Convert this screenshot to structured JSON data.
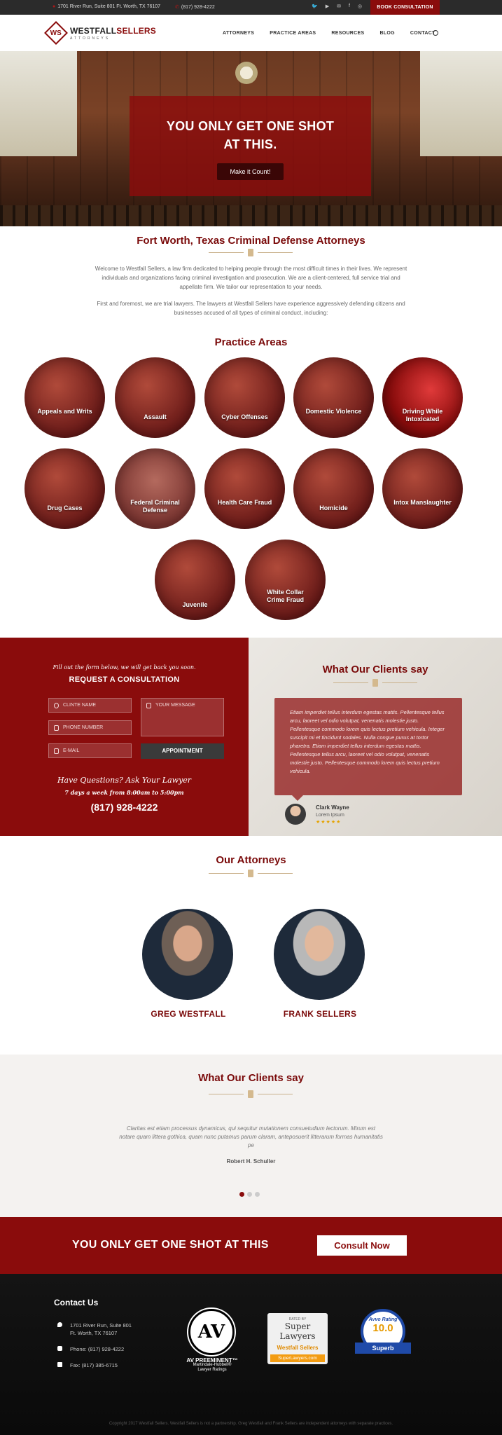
{
  "topbar": {
    "address": "1701 River Run, Suite 801  Ft. Worth, TX 76107",
    "phone": "(817) 928-4222",
    "social": [
      "twitter-icon",
      "youtube-icon",
      "email-icon",
      "facebook-icon",
      "rss-icon"
    ],
    "social_glyphs": [
      "🐦",
      "▶",
      "✉",
      "f",
      "◎"
    ],
    "book_label": "BOOK CONSULTATION"
  },
  "header": {
    "logo_mark": "WS",
    "logo_name_1": "WESTFALL",
    "logo_name_2": "SELLERS",
    "logo_sub": "ATTORNEYS",
    "nav": [
      "ATTORNEYS",
      "PRACTICE AREAS",
      "RESOURCES",
      "BLOG",
      "CONTACT"
    ]
  },
  "hero": {
    "headline_1": "YOU ONLY GET ONE SHOT",
    "headline_2": "AT THIS.",
    "button": "Make it Count!"
  },
  "intro": {
    "title": "Fort Worth, Texas Criminal Defense Attorneys",
    "p1": "Welcome to Westfall Sellers, a law firm dedicated to helping people through the most difficult times in their lives. We represent individuals and organizations facing criminal investigation and prosecution. We are a client-centered, full service trial and appellate firm. We tailor our representation to your needs.",
    "p2": "First and foremost, we are trial lawyers. The lawyers at Westfall Sellers have experience aggressively defending citizens and businesses accused of all types of criminal conduct, including:"
  },
  "practice": {
    "title": "Practice Areas",
    "items": [
      "Appeals and Writs",
      "Assault",
      "Cyber Offenses",
      "Domestic Violence",
      "Driving While Intoxicated",
      "Drug Cases",
      "Federal Criminal Defense",
      "Health Care Fraud",
      "Homicide",
      "Intox Manslaughter",
      "Juvenile",
      "White Collar Crime Fraud"
    ]
  },
  "consult": {
    "lead": "Fill out the form below, we will get back you soon.",
    "title": "REQUEST A CONSULTATION",
    "name_placeholder": "CLINTE NAME",
    "phone_placeholder": "PHONE NUMBER",
    "email_placeholder": "E-MAIL",
    "message_placeholder": "YOUR MESSAGE",
    "submit": "APPOINTMENT",
    "question": "Have Questions? Ask Your Lawyer",
    "hours": "7 days a week from 8:00am to 5:00pm",
    "phone": "(817) 928-4222"
  },
  "testimonial": {
    "title": "What Our Clients say",
    "text": "Etiam imperdiet tellus interdum egestas mattis. Pellentesque tellus arcu, laoreet vel odio volutpat, venenatis molestie justo. Pellentesque commodo lorem quis lectus pretium vehicula. Integer suscipit mi et tincidunt sodales. Nulla congue purus at tortor pharetra. Etiam imperdiet tellus interdum egestas mattis. Pellentesque tellus arcu, laoreet vel odio volutpat, venenatis molestie justo. Pellentesque commodo lorem quis lectus pretium vehicula.",
    "name": "Clark Wayne",
    "role": "Lorem Ipsum",
    "stars": "★★★★★"
  },
  "attorneys": {
    "title": "Our Attorneys",
    "people": [
      "GREG WESTFALL",
      "FRANK SELLERS"
    ]
  },
  "clients2": {
    "title": "What Our Clients say",
    "quote": "Claritas est etiam processus dynamicus, qui sequitur mutationem consuetudium lectorum. Mirum est notare quam littera gothica, quam nunc putamus parum claram, anteposuerit litterarum formas humanitatis pe",
    "author": "Robert H. Schuller"
  },
  "cta": {
    "text": "YOU ONLY GET ONE SHOT AT THIS",
    "button": "Consult Now"
  },
  "footer": {
    "title": "Contact Us",
    "address_1": "1701 River Run, Suite 801",
    "address_2": "Ft. Worth, TX 76107",
    "phone": "Phone: (817) 928-4222",
    "fax": "Fax: (817) 385-6715",
    "av_logo": "AV",
    "av_line1": "AV PREEMINENT™",
    "av_line2": "Martindale-Hubbell®",
    "av_line3": "Lawyer Ratings",
    "sl_rated": "RATED BY",
    "sl_name": "Super Lawyers",
    "sl_firm": "Westfall Sellers",
    "sl_site": "SuperLawyers.com",
    "avvo_label": "Avvo Rating",
    "avvo_score": "10.0",
    "avvo_word": "Superb",
    "copyright": "Copyright 2017 Westfall Sellers. Westfall Sellers is not a partnership. Greg Westfall and Frank Sellers are independent attorneys with separate practices."
  },
  "colors": {
    "brand": "#8a0c0c",
    "dark": "#2b2b2b",
    "gold": "#d4b98e"
  }
}
